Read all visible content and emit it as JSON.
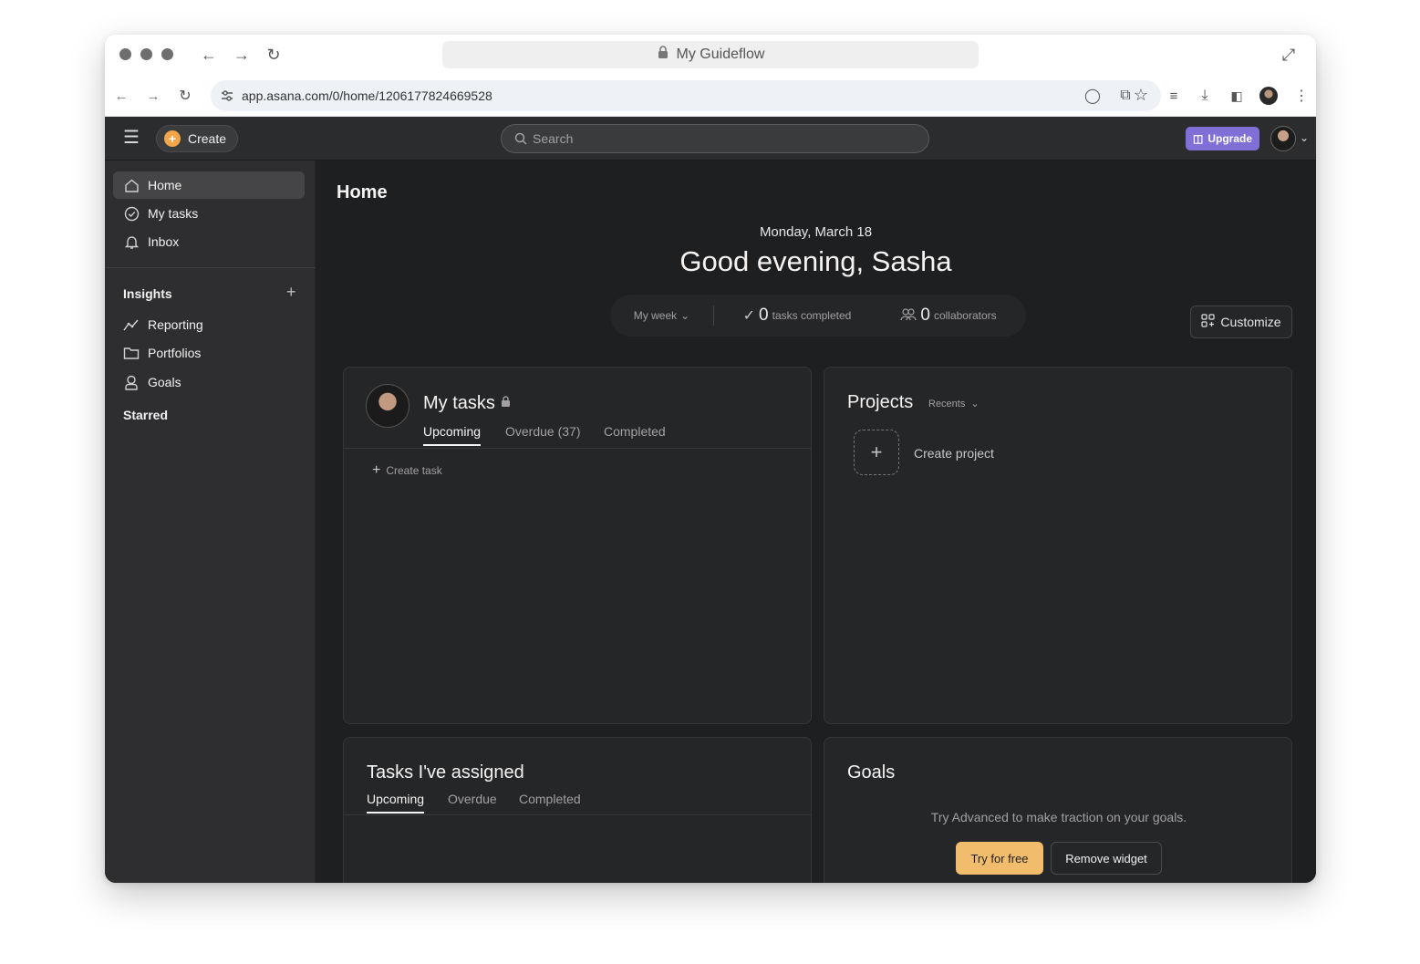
{
  "browser": {
    "title": "My Guideflow",
    "url": "app.asana.com/0/home/1206177824669528"
  },
  "topnav": {
    "create_label": "Create",
    "search_placeholder": "Search",
    "upgrade_label": "Upgrade"
  },
  "sidebar": {
    "items": [
      {
        "label": "Home",
        "icon": "home-icon",
        "active": true
      },
      {
        "label": "My tasks",
        "icon": "check-circle-icon"
      },
      {
        "label": "Inbox",
        "icon": "bell-icon"
      }
    ],
    "insights_heading": "Insights",
    "insights_items": [
      {
        "label": "Reporting",
        "icon": "trend-line-icon"
      },
      {
        "label": "Portfolios",
        "icon": "folder-icon"
      },
      {
        "label": "Goals",
        "icon": "person-icon"
      }
    ],
    "starred_heading": "Starred"
  },
  "main": {
    "page_title": "Home",
    "date": "Monday, March 18",
    "greeting": "Good evening, Sasha",
    "stats": {
      "period": "My week",
      "tasks_count": "0",
      "tasks_label": "tasks completed",
      "collab_count": "0",
      "collab_label": "collaborators"
    },
    "customize_label": "Customize"
  },
  "my_tasks": {
    "title": "My tasks",
    "tabs": [
      "Upcoming",
      "Overdue (37)",
      "Completed"
    ],
    "create_task": "Create task"
  },
  "projects": {
    "title": "Projects",
    "filter": "Recents",
    "create_project": "Create project"
  },
  "assigned": {
    "title": "Tasks I've assigned",
    "tabs": [
      "Upcoming",
      "Overdue",
      "Completed"
    ]
  },
  "goals": {
    "title": "Goals",
    "message": "Try Advanced to make traction on your goals.",
    "try_label": "Try for free",
    "remove_label": "Remove widget"
  },
  "colors": {
    "accent_upgrade": "#7f6fd6",
    "accent_try": "#f1bd6c",
    "create_plus": "#f3a54a",
    "app_bg": "#1e1f21"
  }
}
